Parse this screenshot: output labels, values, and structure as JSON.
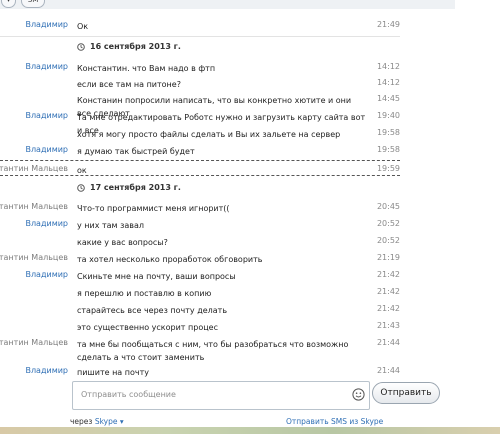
{
  "toolbar": {
    "btn_a": "▾",
    "btn_b": "SM"
  },
  "chat": {
    "first": {
      "sender": "Владимир",
      "text": "Ок",
      "time": "21:49"
    },
    "date1": "16 сентября 2013 г.",
    "day1": [
      {
        "sender": "Владимир",
        "text": "Константин. что Вам надо в фтп",
        "time": "14:12"
      },
      {
        "sender": "",
        "text": "если все там на питоне?",
        "time": "14:12"
      },
      {
        "sender": "",
        "text": "Констанин попросили написать, что вы конкретно хютите и они все сделают",
        "time": "14:45"
      },
      {
        "sender": "Владимир",
        "text": "Та мне отредактировать Роботс нужно и загрузить карту сайта вот и все",
        "time": "19:40"
      },
      {
        "sender": "",
        "text": "хотя я могу просто файлы сделать и Вы их зальете на сервер",
        "time": "19:58"
      },
      {
        "sender": "Владимир",
        "text": "я думаю так быстрей будет",
        "time": "19:58"
      },
      {
        "sender": "Константин Мальцев",
        "text": "ок",
        "time": "19:59"
      }
    ],
    "date2": "17 сентября 2013 г.",
    "day2": [
      {
        "sender": "Константин Мальцев",
        "text": "Что-то программист меня игнорит((",
        "time": "20:45"
      },
      {
        "sender": "Владимир",
        "text": "у них там завал",
        "time": "20:52"
      },
      {
        "sender": "",
        "text": "какие у вас вопросы?",
        "time": "20:52"
      },
      {
        "sender": "Константин Мальцев",
        "text": "та хотел несколько проработок обговорить",
        "time": "21:19"
      },
      {
        "sender": "Владимир",
        "text": "Скиньте мне на почту, ваши вопросы",
        "time": "21:42"
      },
      {
        "sender": "",
        "text": "я перешлю и поставлю в копию",
        "time": "21:42"
      },
      {
        "sender": "",
        "text": "старайтесь все через почту делать",
        "time": "21:42"
      },
      {
        "sender": "",
        "text": "это существенно ускорит процес",
        "time": "21:43"
      },
      {
        "sender": "Константин Мальцев",
        "text": "та мне бы пообщаться с ним, что бы разобраться что возможно сделать а что стоит заменить",
        "time": "21:44"
      },
      {
        "sender": "Владимир",
        "text": "пишите на почту",
        "time": "21:44"
      }
    ]
  },
  "compose": {
    "placeholder": "Отправить сообщение",
    "send_label": "Отправить",
    "via_label": "через",
    "via_link": "Skype ▾",
    "sms_label": "Отправить SMS из Skype"
  },
  "colors": {
    "sender_blue": "#2f6fb5",
    "sender_gray": "#7d7d7d"
  },
  "icons": {
    "date": "calendar-icon",
    "smile": "smile-icon"
  }
}
